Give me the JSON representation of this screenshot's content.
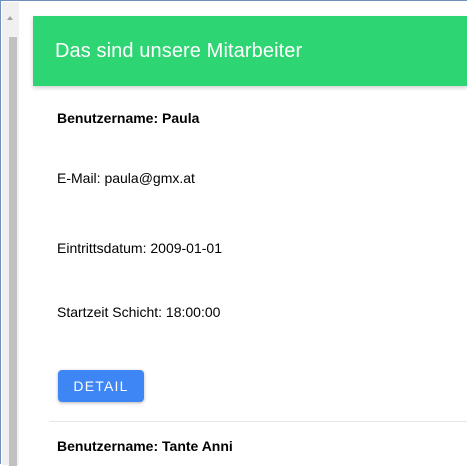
{
  "header": {
    "title": "Das sind unsere Mitarbeiter"
  },
  "employees": [
    {
      "name_label": "Benutzername: Paula",
      "email_label": "E-Mail: paula@gmx.at",
      "entry_label": "Eintrittsdatum: 2009-01-01",
      "shift_label": "Startzeit Schicht: 18:00:00",
      "detail_button": "DETAIL"
    },
    {
      "name_label": "Benutzername: Tante Anni"
    }
  ],
  "colors": {
    "header_bg": "#2ed573",
    "button_bg": "#3e86f5"
  }
}
